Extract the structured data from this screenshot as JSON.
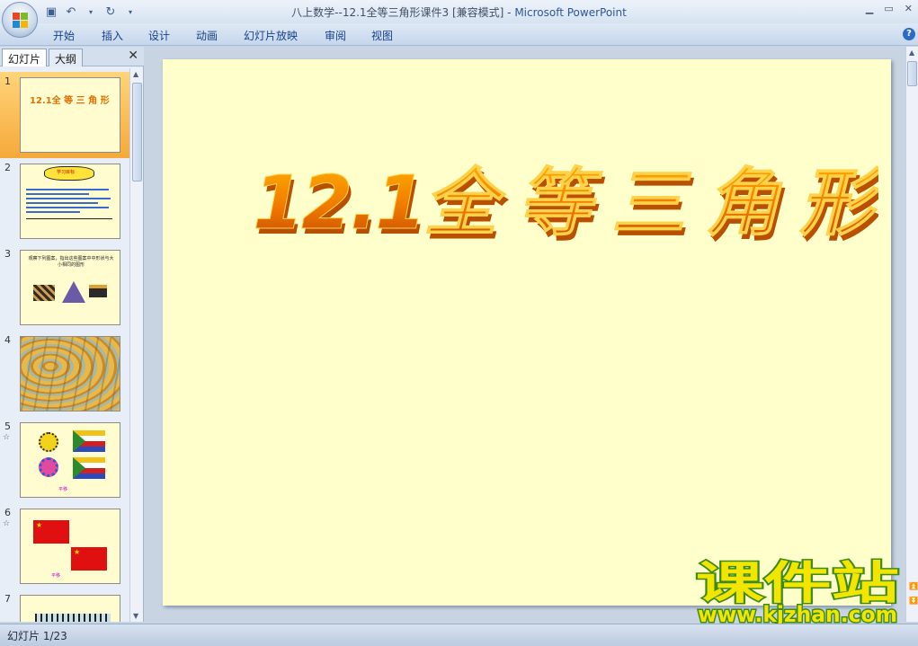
{
  "window": {
    "title": "八上数学--12.1全等三角形课件3 [兼容模式]",
    "app_name": "Microsoft PowerPoint",
    "separator": " - "
  },
  "ribbon": {
    "tabs": [
      "开始",
      "插入",
      "设计",
      "动画",
      "幻灯片放映",
      "审阅",
      "视图"
    ]
  },
  "panel": {
    "tabs": [
      "幻灯片",
      "大纲"
    ],
    "close_glyph": "✕"
  },
  "thumbnails": [
    {
      "num": "1",
      "title": "12.1全 等 三 角 形"
    },
    {
      "num": "2",
      "badge": "学习目标"
    },
    {
      "num": "3",
      "caption": "观察下列图案，指出这些图案中中形状与大小相同的图形"
    },
    {
      "num": "4"
    },
    {
      "num": "5",
      "caption": "平移"
    },
    {
      "num": "6",
      "caption": "平移"
    },
    {
      "num": "7"
    }
  ],
  "slide": {
    "title": "12.1全 等 三 角 形"
  },
  "watermark": {
    "line1": "课件站",
    "line2": "www.kjzhan.com"
  },
  "status": {
    "text": "幻灯片 1/23"
  },
  "colors": {
    "slide_bg": "#ffffcc",
    "wordart": "#f07800",
    "watermark_green": "#3b8a1a",
    "watermark_yellow": "#f2e600"
  }
}
